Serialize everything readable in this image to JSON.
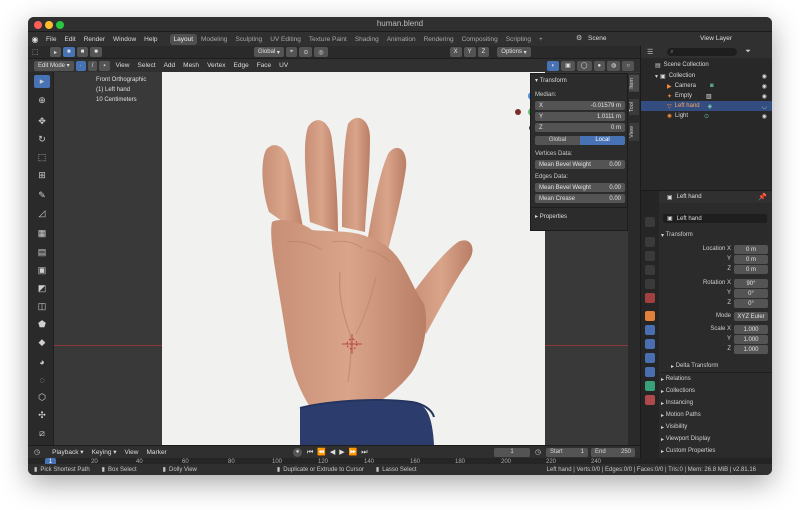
{
  "titlebar": {
    "title": "human.blend"
  },
  "menu": [
    "File",
    "Edit",
    "Render",
    "Window",
    "Help"
  ],
  "workspaces": [
    "Layout",
    "Modeling",
    "Sculpting",
    "UV Editing",
    "Texture Paint",
    "Shading",
    "Animation",
    "Rendering",
    "Compositing",
    "Scripting"
  ],
  "scene": {
    "name": "Scene",
    "view_layer": "View Layer"
  },
  "header": {
    "orientation": "Global",
    "options": "Options"
  },
  "subheader": {
    "mode": "Edit Mode",
    "items": [
      "View",
      "Select",
      "Add",
      "Mesh",
      "Vertex",
      "Edge",
      "Face",
      "UV"
    ]
  },
  "viewport": {
    "view_name": "Front Orthographic",
    "object_label": "(1) Left hand",
    "scale_label": "10 Centimeters"
  },
  "npanel": {
    "transform_title": "Transform",
    "median_label": "Median:",
    "x_label": "X",
    "x_value": "-0.01579 m",
    "y_label": "Y",
    "y_value": "1.0111 m",
    "z_label": "Z",
    "z_value": "0 m",
    "global_label": "Global",
    "local_label": "Local",
    "vertices_data": "Vertices Data:",
    "mean_bevel_weight_v": "Mean Bevel Weight",
    "mean_bevel_weight_v_value": "0.00",
    "edges_data": "Edges Data:",
    "mean_bevel_weight_e": "Mean Bevel Weight",
    "mean_bevel_weight_e_value": "0.00",
    "mean_crease": "Mean Crease",
    "mean_crease_value": "0.00",
    "properties_title": "Properties"
  },
  "sidetabs": [
    "Item",
    "Tool",
    "View"
  ],
  "outliner": {
    "items": [
      {
        "label": "Scene Collection"
      },
      {
        "label": "Collection"
      },
      {
        "label": "Camera"
      },
      {
        "label": "Empty"
      },
      {
        "label": "Left hand"
      },
      {
        "label": "Light"
      }
    ]
  },
  "properties": {
    "object_name": "Left hand",
    "object_field": "Left hand",
    "transform_title": "Transform",
    "location_x_label": "Location X",
    "location_x": "0 m",
    "location_y_label": "Y",
    "location_y": "0 m",
    "location_z_label": "Z",
    "location_z": "0 m",
    "rotation_x_label": "Rotation X",
    "rotation_x": "90°",
    "rotation_y_label": "Y",
    "rotation_y": "0°",
    "rotation_z_label": "Z",
    "rotation_z": "0°",
    "mode_label": "Mode",
    "mode_value": "XYZ Euler",
    "scale_x_label": "Scale X",
    "scale_x": "1.000",
    "scale_y_label": "Y",
    "scale_y": "1.000",
    "scale_z_label": "Z",
    "scale_z": "1.000",
    "delta_transform": "Delta Transform",
    "sections": [
      "Relations",
      "Collections",
      "Instancing",
      "Motion Paths",
      "Visibility",
      "Viewport Display",
      "Custom Properties"
    ]
  },
  "timeline": {
    "menus": [
      "Playback",
      "Keying",
      "View",
      "Marker"
    ],
    "current_frame": "1",
    "start_label": "Start",
    "start": "1",
    "end_label": "End",
    "end": "250",
    "ruler_ticks": [
      "1",
      "20",
      "40",
      "60",
      "80",
      "100",
      "120",
      "140",
      "160",
      "180",
      "200",
      "220",
      "240"
    ]
  },
  "statusbar": {
    "items": [
      "Pick Shortest Path",
      "Box Select",
      "Dolly View",
      "Duplicate or Extrude to Cursor",
      "Lasso Select"
    ],
    "info": "Left hand | Verts:0/0 | Edges:0/0 | Faces:0/0 | Tris:0 | Mem: 26.8 MiB | v2.81.16"
  },
  "colors": {
    "accent_blue": "#4772b3",
    "traffic_red": "#ff5f57",
    "traffic_yellow": "#febc2e",
    "traffic_green": "#28c840"
  }
}
